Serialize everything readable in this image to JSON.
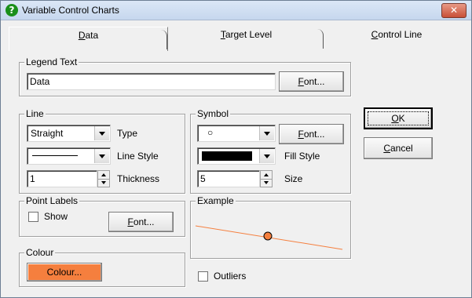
{
  "window": {
    "title": "Variable Control Charts",
    "close_glyph": "✕",
    "app_icon_glyph": "?",
    "app_icon": "help-question-icon"
  },
  "tabs": [
    {
      "label": "Data",
      "mnemonic": "D",
      "rest": "ata",
      "selected": true
    },
    {
      "label": "Target Level",
      "mnemonic": "T",
      "rest": "arget Level",
      "selected": false
    },
    {
      "label": "Control Line",
      "mnemonic": "C",
      "rest": "ontrol Line",
      "selected": false
    }
  ],
  "legend_text": {
    "group_label": "Legend Text",
    "value": "Data",
    "font_button": {
      "mnemonic": "F",
      "rest": "ont..."
    }
  },
  "line": {
    "group_label": "Line",
    "type_value": "Straight",
    "type_label": "Type",
    "style_label": "Line Style",
    "style_value": "solid",
    "thickness_value": "1",
    "thickness_label": "Thickness"
  },
  "symbol": {
    "group_label": "Symbol",
    "symbol_value": "○",
    "font_button": {
      "mnemonic": "F",
      "rest": "ont..."
    },
    "fill_style_label": "Fill Style",
    "fill_style_value": "solid black",
    "fill_color": "#000000",
    "size_value": "5",
    "size_label": "Size"
  },
  "point_labels": {
    "group_label": "Point Labels",
    "show_label": "Show",
    "show_checked": false,
    "font_button": {
      "mnemonic": "F",
      "rest": "ont..."
    }
  },
  "colour": {
    "group_label": "Colour",
    "button_label": "Colour...",
    "colour_hex": "#f57f3e"
  },
  "example": {
    "group_label": "Example",
    "line_color": "#f57f3e"
  },
  "outliers": {
    "label": "Outliers",
    "checked": false
  },
  "buttons": {
    "ok": {
      "mnemonic": "O",
      "rest": "K"
    },
    "cancel": {
      "mnemonic": "C",
      "rest": "ancel"
    }
  }
}
